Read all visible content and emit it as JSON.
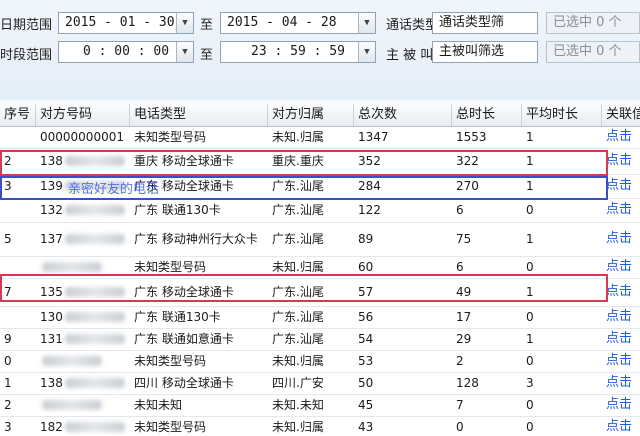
{
  "filters": {
    "date_range_label": "日期范围",
    "date_start": "2015 - 01 - 30",
    "to1": "至",
    "date_end": "2015 - 04 - 28",
    "time_range_label": "时段范围",
    "time_start": "0 : 00 : 00",
    "to2": "至",
    "time_end": "23 : 59 : 59",
    "call_type_label": "通话类型",
    "call_type_value": "通话类型筛",
    "call_type_selected": "已选中 0 个",
    "direction_label": "主 被 叫",
    "direction_value": "主被叫筛选",
    "direction_selected": "已选中 0 个",
    "dropdown_arrow": "▼"
  },
  "table": {
    "headers": [
      "序号",
      "对方号码",
      "电话类型",
      "对方归属",
      "总次数",
      "总时长",
      "平均时长",
      "关联信"
    ],
    "link_text": "点击",
    "rows": [
      {
        "seq": "",
        "number": "00000000001",
        "masked": false,
        "type": "未知类型号码",
        "location": "未知.归属",
        "count": "1347",
        "duration": "1553",
        "avg": "1"
      },
      {
        "seq": "2",
        "number": "138",
        "masked": true,
        "type": "重庆 移动全球通卡",
        "location": "重庆.重庆",
        "count": "352",
        "duration": "322",
        "avg": "1"
      },
      {
        "seq": "3",
        "number": "139",
        "masked": true,
        "type": "广东 移动全球通卡",
        "location": "广东.汕尾",
        "count": "284",
        "duration": "270",
        "avg": "1"
      },
      {
        "seq": "",
        "number": "132",
        "masked": true,
        "type": "广东 联通130卡",
        "location": "广东.汕尾",
        "count": "122",
        "duration": "6",
        "avg": "0"
      },
      {
        "seq": "5",
        "number": "137",
        "masked": true,
        "type": "广东 移动神州行大众卡",
        "location": "广东.汕尾",
        "count": "89",
        "duration": "75",
        "avg": "1"
      },
      {
        "seq": "",
        "number": "",
        "masked": true,
        "type": "未知类型号码",
        "location": "未知.归属",
        "count": "60",
        "duration": "6",
        "avg": "0"
      },
      {
        "seq": "7",
        "number": "135",
        "masked": true,
        "type": "广东 移动全球通卡",
        "location": "广东.汕尾",
        "count": "57",
        "duration": "49",
        "avg": "1"
      },
      {
        "seq": "",
        "number": "130",
        "masked": true,
        "type": "广东 联通130卡",
        "location": "广东.汕尾",
        "count": "56",
        "duration": "17",
        "avg": "0"
      },
      {
        "seq": "9",
        "number": "131",
        "masked": true,
        "type": "广东 联通如意通卡",
        "location": "广东.汕尾",
        "count": "54",
        "duration": "29",
        "avg": "1"
      },
      {
        "seq": "0",
        "number": "",
        "masked": true,
        "type": "未知类型号码",
        "location": "未知.归属",
        "count": "53",
        "duration": "2",
        "avg": "0"
      },
      {
        "seq": "1",
        "number": "138",
        "masked": true,
        "type": "四川 移动全球通卡",
        "location": "四川.广安",
        "count": "50",
        "duration": "128",
        "avg": "3"
      },
      {
        "seq": "2",
        "number": "",
        "masked": true,
        "type": "未知未知",
        "location": "未知.未知",
        "count": "45",
        "duration": "7",
        "avg": "0"
      },
      {
        "seq": "3",
        "number": "182",
        "masked": true,
        "type": "未知类型号码",
        "location": "未知.归属",
        "count": "43",
        "duration": "0",
        "avg": "0"
      }
    ]
  },
  "overlay_text": "亲密好友的电话",
  "colors": {
    "highlight_red": "#d43a55",
    "highlight_blue": "#3b4fc4",
    "link": "#1f5fd6"
  }
}
